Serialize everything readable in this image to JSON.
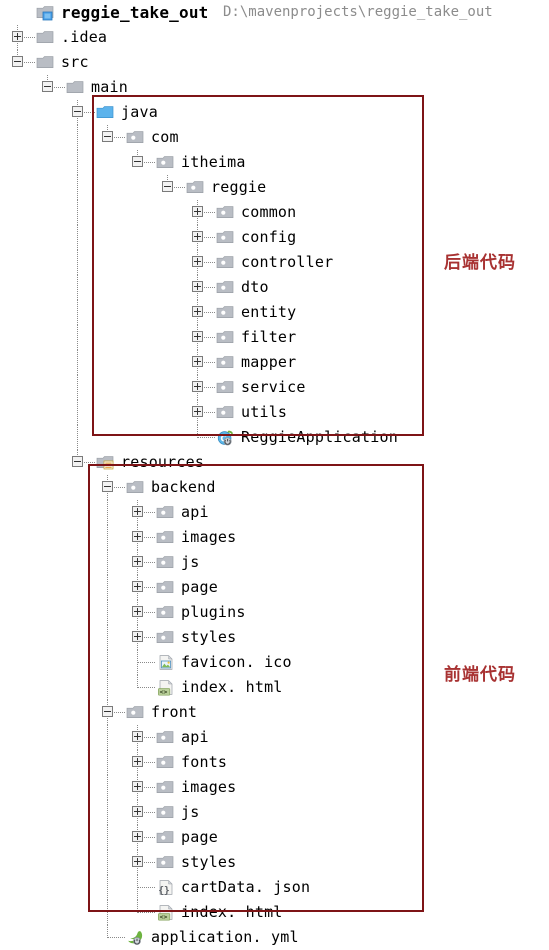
{
  "project": {
    "name": "reggie_take_out",
    "path": "D:\\mavenprojects\\reggie_take_out"
  },
  "annotations": [
    {
      "text": "后端代码",
      "meaning": "backend-code",
      "color": "#a83232"
    },
    {
      "text": "前端代码",
      "meaning": "frontend-code",
      "color": "#a83232"
    }
  ],
  "tree": [
    {
      "label": "reggie_take_out",
      "icon": "project-folder-icon",
      "toggle": "none",
      "depth": 0,
      "bold": true
    },
    {
      "label": ".idea",
      "icon": "folder-icon",
      "toggle": "plus",
      "depth": 0
    },
    {
      "label": "src",
      "icon": "folder-icon",
      "toggle": "minus",
      "depth": 0
    },
    {
      "label": "main",
      "icon": "folder-icon",
      "toggle": "minus",
      "depth": 1
    },
    {
      "label": "java",
      "icon": "source-root-icon",
      "toggle": "minus",
      "depth": 2
    },
    {
      "label": "com",
      "icon": "package-icon",
      "toggle": "minus",
      "depth": 3
    },
    {
      "label": "itheima",
      "icon": "package-icon",
      "toggle": "minus",
      "depth": 4
    },
    {
      "label": "reggie",
      "icon": "package-icon",
      "toggle": "minus",
      "depth": 5
    },
    {
      "label": "common",
      "icon": "package-icon",
      "toggle": "plus",
      "depth": 6
    },
    {
      "label": "config",
      "icon": "package-icon",
      "toggle": "plus",
      "depth": 6
    },
    {
      "label": "controller",
      "icon": "package-icon",
      "toggle": "plus",
      "depth": 6
    },
    {
      "label": "dto",
      "icon": "package-icon",
      "toggle": "plus",
      "depth": 6
    },
    {
      "label": "entity",
      "icon": "package-icon",
      "toggle": "plus",
      "depth": 6
    },
    {
      "label": "filter",
      "icon": "package-icon",
      "toggle": "plus",
      "depth": 6
    },
    {
      "label": "mapper",
      "icon": "package-icon",
      "toggle": "plus",
      "depth": 6
    },
    {
      "label": "service",
      "icon": "package-icon",
      "toggle": "plus",
      "depth": 6
    },
    {
      "label": "utils",
      "icon": "package-icon",
      "toggle": "plus",
      "depth": 6
    },
    {
      "label": "ReggieApplication",
      "icon": "spring-boot-class-icon",
      "toggle": "none",
      "depth": 6
    },
    {
      "label": "resources",
      "icon": "resources-root-icon",
      "toggle": "minus",
      "depth": 2
    },
    {
      "label": "backend",
      "icon": "package-icon",
      "toggle": "minus",
      "depth": 3
    },
    {
      "label": "api",
      "icon": "package-icon",
      "toggle": "plus",
      "depth": 4
    },
    {
      "label": "images",
      "icon": "package-icon",
      "toggle": "plus",
      "depth": 4
    },
    {
      "label": "js",
      "icon": "package-icon",
      "toggle": "plus",
      "depth": 4
    },
    {
      "label": "page",
      "icon": "package-icon",
      "toggle": "plus",
      "depth": 4
    },
    {
      "label": "plugins",
      "icon": "package-icon",
      "toggle": "plus",
      "depth": 4
    },
    {
      "label": "styles",
      "icon": "package-icon",
      "toggle": "plus",
      "depth": 4
    },
    {
      "label": "favicon. ico",
      "icon": "image-file-icon",
      "toggle": "none",
      "depth": 4
    },
    {
      "label": "index. html",
      "icon": "html-file-icon",
      "toggle": "none",
      "depth": 4
    },
    {
      "label": "front",
      "icon": "package-icon",
      "toggle": "minus",
      "depth": 3
    },
    {
      "label": "api",
      "icon": "package-icon",
      "toggle": "plus",
      "depth": 4
    },
    {
      "label": "fonts",
      "icon": "package-icon",
      "toggle": "plus",
      "depth": 4
    },
    {
      "label": "images",
      "icon": "package-icon",
      "toggle": "plus",
      "depth": 4
    },
    {
      "label": "js",
      "icon": "package-icon",
      "toggle": "plus",
      "depth": 4
    },
    {
      "label": "page",
      "icon": "package-icon",
      "toggle": "plus",
      "depth": 4
    },
    {
      "label": "styles",
      "icon": "package-icon",
      "toggle": "plus",
      "depth": 4
    },
    {
      "label": "cartData. json",
      "icon": "json-file-icon",
      "toggle": "none",
      "depth": 4
    },
    {
      "label": "index. html",
      "icon": "html-file-icon",
      "toggle": "none",
      "depth": 4
    },
    {
      "label": "application. yml",
      "icon": "spring-config-icon",
      "toggle": "none",
      "depth": 3
    }
  ]
}
